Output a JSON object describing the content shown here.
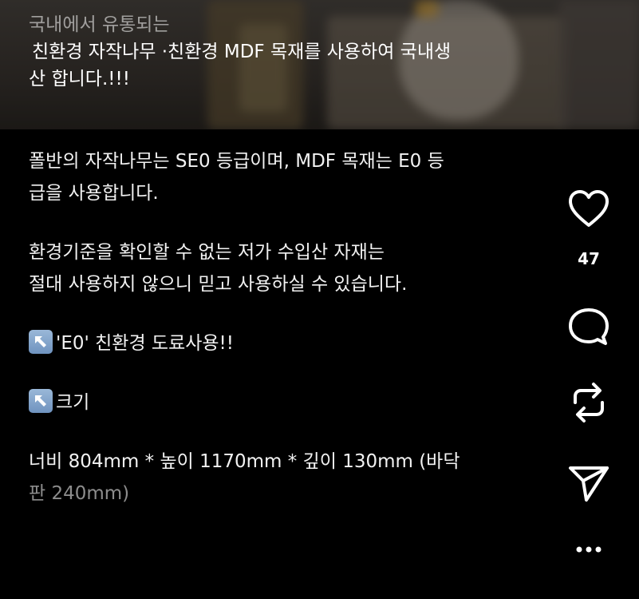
{
  "caption_top": {
    "line1": "국내에서 유통되는",
    "line2": "친환경 자작나무 ·친환경 MDF 목재를 사용하여 국내생",
    "line3": "산 합니다.!!!"
  },
  "body": {
    "p1_line1": "폴반의 자작나무는 SE0 등급이며, MDF 목재는 E0 등",
    "p1_line2": "급을 사용합니다.",
    "p2_line1": "환경기준을 확인할 수 없는 저가 수입산 자재는",
    "p2_line2": "절대 사용하지 않으니 믿고 사용하실 수 있습니다.",
    "p3": "'E0' 친환경 도료사용!!",
    "p4": "크기",
    "p5_line1": "너비 804mm * 높이 1170mm * 깊이 130mm (바닥",
    "p5_line2": "판 240mm)"
  },
  "actions": {
    "like_icon": "heart-icon",
    "like_count": "47",
    "comment_icon": "comment-icon",
    "repost_icon": "repost-icon",
    "share_icon": "send-icon",
    "more_icon": "more-icon"
  },
  "colors": {
    "background": "#000000",
    "text": "#ffffff",
    "emoji_bg": "#7ea1c9"
  }
}
